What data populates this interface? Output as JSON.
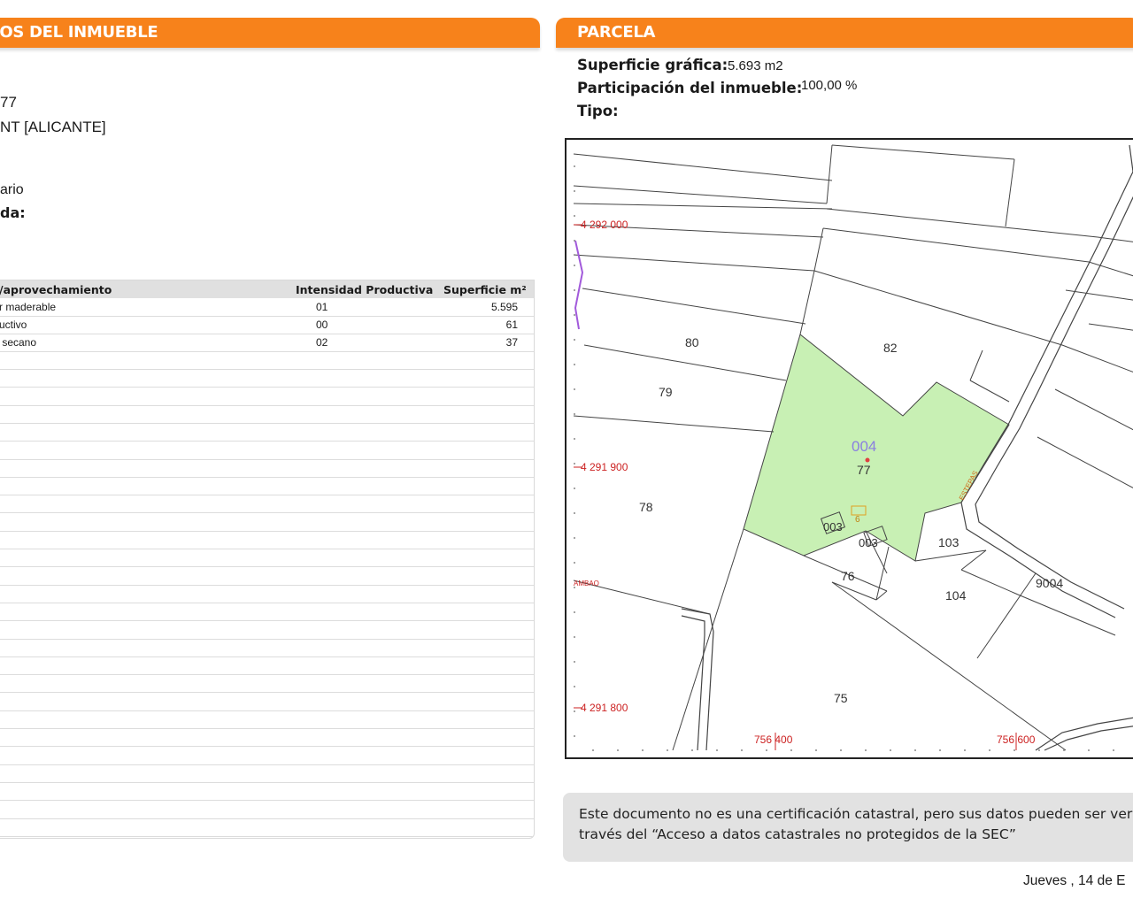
{
  "left_panel": {
    "header": "VOS DEL INMUEBLE",
    "line_ref": "77",
    "line_municipio": "NT [ALICANTE]",
    "line_uso": "ario",
    "line_construida": "da:",
    "table": {
      "headers": [
        "/aprovechamiento",
        "Intensidad Productiva",
        "Superficie m²"
      ],
      "rows": [
        {
          "cultivo": "r maderable",
          "intensidad": "01",
          "superficie": "5.595"
        },
        {
          "cultivo": "uctivo",
          "intensidad": "00",
          "superficie": "61"
        },
        {
          "cultivo": " secano",
          "intensidad": "02",
          "superficie": "37"
        }
      ]
    }
  },
  "right_panel": {
    "header": "PARCELA",
    "superficie_label": "Superficie gráfica:",
    "superficie_value": "5.693 m2",
    "participacion_label": "Participación del inmueble:",
    "participacion_value": "100,00 %",
    "tipo_label": "Tipo:"
  },
  "map": {
    "coord_y_top": "4 292 000",
    "coord_y_mid": "4 291 900",
    "coord_y_bot": "4 291 800",
    "coord_x_left": "756 400",
    "coord_x_right": "756 600",
    "parcel_polygon": "004",
    "parcel_main": "77",
    "road_label": "ESTEPAS",
    "roadside_label": "AMBAO",
    "labels": {
      "p80": "80",
      "p82": "82",
      "p79": "79",
      "p78": "78",
      "p003a": "003",
      "p003b": "003",
      "p103": "103",
      "p76": "76",
      "p104": "104",
      "p9004": "9004",
      "p75": "75",
      "p6": "6"
    },
    "colors": {
      "parcel_fill": "#c8f0b4",
      "accent": "#f7821b",
      "coord_red": "#cc2222",
      "polygon_id": "#8a7fe0"
    }
  },
  "note": {
    "line1": "Este documento no es una certificación catastral, pero sus datos pueden ser veri",
    "line2": "través del “Acceso a datos catastrales no protegidos de la SEC”"
  },
  "footer": {
    "date": "Jueves , 14 de E"
  }
}
